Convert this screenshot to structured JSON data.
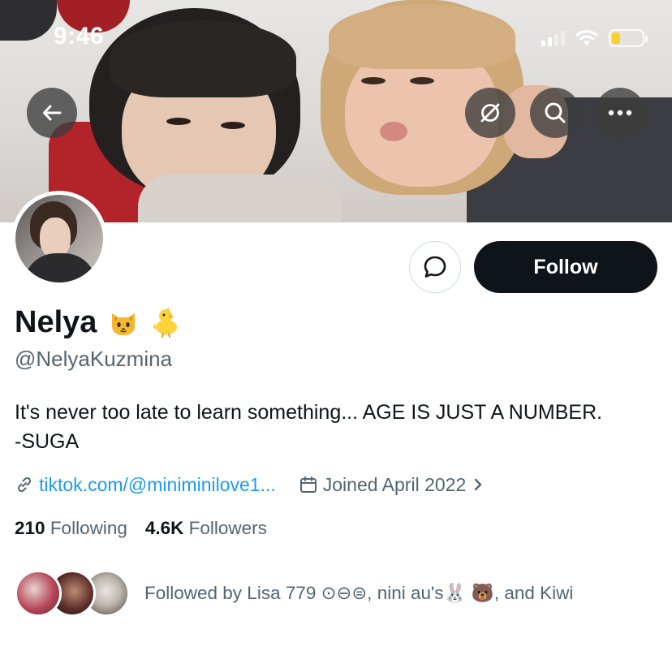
{
  "status_bar": {
    "time": "9:46",
    "icons": [
      "signal-icon",
      "wifi-icon",
      "battery-icon"
    ],
    "battery_color": "#f7d327"
  },
  "header": {
    "back_icon": "arrow-left-icon",
    "grok_icon": "grok-icon",
    "search_icon": "search-icon",
    "more_icon": "more-horizontal-icon"
  },
  "profile": {
    "display_name": "Nelya",
    "name_emojis": [
      "🐱",
      "🐤"
    ],
    "handle": "@NelyaKuzmina",
    "bio_lines": [
      "It's never too late to learn something... AGE IS JUST A NUMBER.",
      "-SUGA"
    ],
    "link": "tiktok.com/@miniminilove1...",
    "joined": "Joined April 2022",
    "following_count": "210",
    "following_label": "Following",
    "followers_count": "4.6K",
    "followers_label": "Followers",
    "followed_by": "Followed by Lisa 779 ⊙⊖⊜, nini au's🐰 🐻, and Kiwi"
  },
  "actions": {
    "follow_label": "Follow",
    "message_icon": "message-bubble-icon"
  },
  "colors": {
    "primary_text": "#0f1419",
    "secondary_text": "#536471",
    "link": "#1d9bf0",
    "follow_button_bg": "#0f1419"
  }
}
